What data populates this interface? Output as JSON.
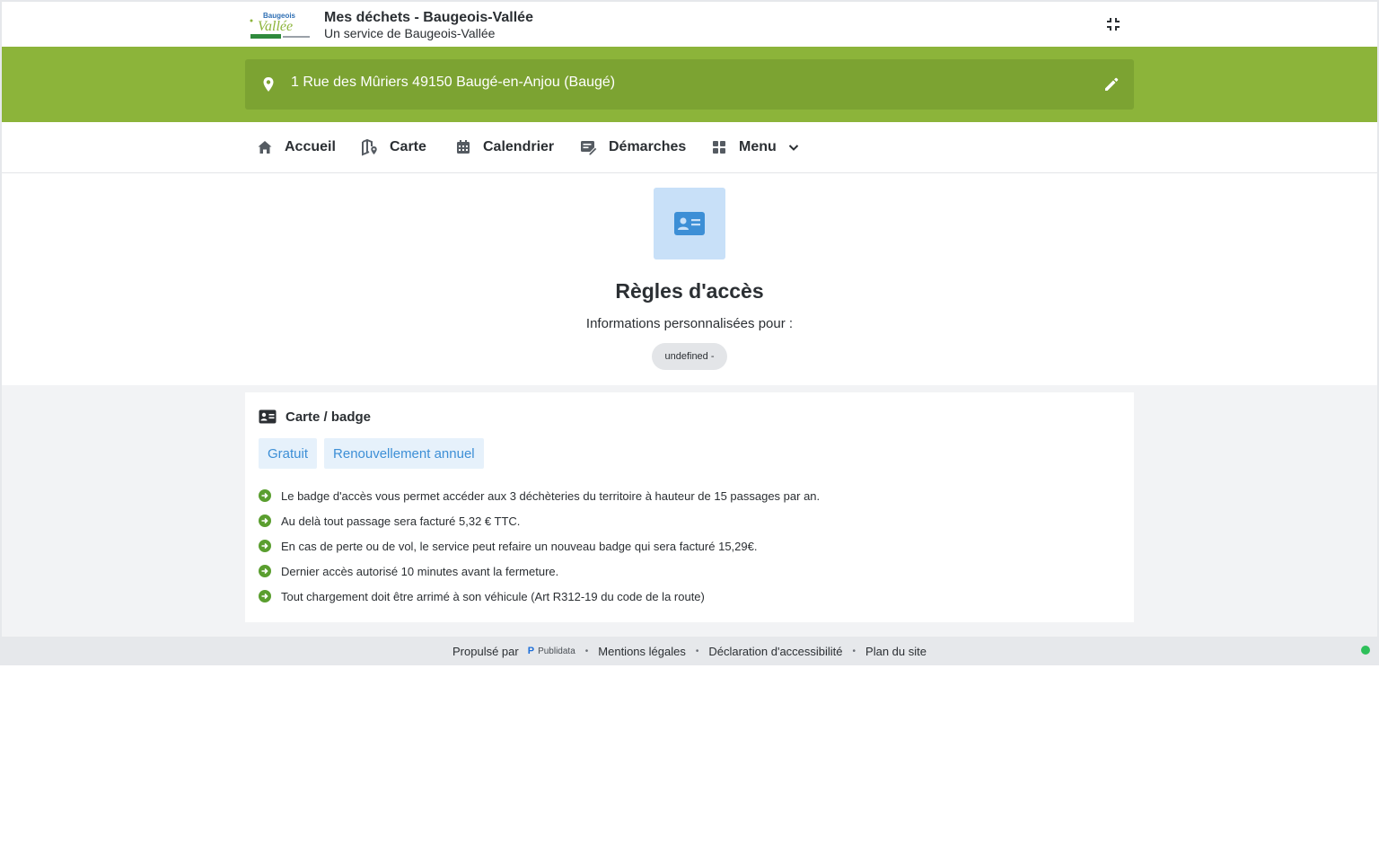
{
  "header": {
    "title": "Mes déchets - Baugeois-Vallée",
    "subtitle": "Un service de Baugeois-Vallée",
    "logo_text_top": "Baugeois",
    "logo_text_main": "Vallée",
    "collapse_icon": "collapse-icon"
  },
  "address": {
    "text": "1 Rue des Mûriers 49150 Baugé-en-Anjou (Baugé)",
    "pin_icon": "location-pin-icon",
    "edit_icon": "pencil-icon"
  },
  "nav": {
    "items": [
      {
        "label": "Accueil",
        "icon": "home-icon"
      },
      {
        "label": "Carte",
        "icon": "map-icon"
      },
      {
        "label": "Calendrier",
        "icon": "calendar-icon"
      },
      {
        "label": "Démarches",
        "icon": "form-edit-icon"
      },
      {
        "label": "Menu",
        "icon": "grid-icon"
      }
    ]
  },
  "hero": {
    "icon": "id-card-icon",
    "title": "Règles d'accès",
    "subtitle": "Informations personnalisées pour :",
    "chip": "undefined -"
  },
  "card": {
    "title": "Carte / badge",
    "icon": "id-card-icon",
    "tags": [
      "Gratuit",
      "Renouvellement annuel"
    ],
    "bullets": [
      "Le badge d'accès vous permet accéder aux 3 déchèteries du territoire à hauteur de 15 passages par an.",
      "Au delà tout passage sera facturé 5,32 € TTC.",
      "En cas de perte ou de vol, le service peut refaire un nouveau badge qui sera facturé 15,29€.",
      "Dernier accès autorisé 10 minutes avant la fermeture.",
      "Tout chargement doit être arrimé à son véhicule (Art R312-19 du code de la route)"
    ]
  },
  "footer": {
    "powered_by": "Propulsé par",
    "brand": "Publidata",
    "links": [
      "Mentions légales",
      "Déclaration d'accessibilité",
      "Plan du site"
    ],
    "separator": "•"
  },
  "colors": {
    "band": "#8cb43a",
    "address_bar": "#7ca332",
    "accent_blue": "#3d8fd6",
    "bullet_green": "#5a9e2f",
    "status_green": "#2ec05a"
  }
}
